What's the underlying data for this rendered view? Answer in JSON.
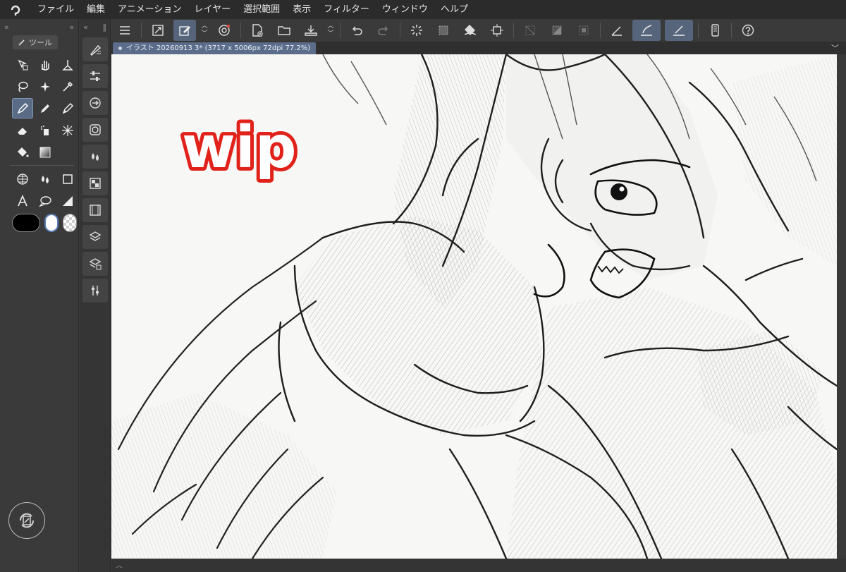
{
  "app": {
    "logo_icon": "clip-studio-logo-icon",
    "accent_color": "#5b6d8a"
  },
  "menu": {
    "items": [
      "ファイル",
      "編集",
      "アニメーション",
      "レイヤー",
      "選択範囲",
      "表示",
      "フィルター",
      "ウィンドウ",
      "ヘルプ"
    ]
  },
  "tool_panel": {
    "tab_label": "ツール",
    "tools": [
      {
        "name": "operation-tool",
        "icon": "cursor-cube-icon"
      },
      {
        "name": "move-tool",
        "icon": "hand-icon"
      },
      {
        "name": "move-layer-tool",
        "icon": "move-layer-icon"
      },
      {
        "name": "lasso-tool",
        "icon": "lasso-icon"
      },
      {
        "name": "auto-select-tool",
        "icon": "sparkle-icon"
      },
      {
        "name": "eyedropper-tool",
        "icon": "eyedropper-icon"
      },
      {
        "name": "pen-tool",
        "icon": "pen-icon",
        "active": true
      },
      {
        "name": "pencil-tool",
        "icon": "pencil-icon"
      },
      {
        "name": "brush-tool",
        "icon": "brush-icon"
      },
      {
        "name": "eraser-tool",
        "icon": "eraser-icon"
      },
      {
        "name": "airbrush-tool",
        "icon": "airbrush-icon"
      },
      {
        "name": "decoration-tool",
        "icon": "burst-icon"
      },
      {
        "name": "fill-tool",
        "icon": "bucket-icon"
      },
      {
        "name": "gradient-tool",
        "icon": "gradient-icon"
      },
      {
        "name": "figure-tool",
        "icon": "shape-icon"
      },
      {
        "name": "frame-tool",
        "icon": "grid-frame-icon"
      },
      {
        "name": "blend-tool",
        "icon": "droplets-icon"
      },
      {
        "name": "rectangle-tool",
        "icon": "square-icon"
      },
      {
        "name": "text-tool",
        "icon": "text-a-icon"
      },
      {
        "name": "balloon-tool",
        "icon": "speech-bubble-icon"
      },
      {
        "name": "ruler-tool",
        "icon": "ruler-triangle-icon"
      }
    ],
    "main_color": "#000000",
    "sub_color": "#ffffff"
  },
  "palette_column": {
    "buttons": [
      "brush-settings-icon",
      "sliders-icon",
      "sub-tool-icon",
      "color-circle-icon",
      "droplets-icon",
      "material-icon",
      "filmstrip-icon",
      "layers-icon",
      "layer-property-icon",
      "adjust-icon"
    ]
  },
  "command_bar": {
    "buttons": [
      "hamburger-menu-icon",
      "new-canvas-icon",
      "edit-icon",
      "spiral-icon",
      "new-file-icon",
      "open-folder-icon",
      "save-icon",
      "undo-icon",
      "redo-icon",
      "loading-icon",
      "select-all-icon",
      "fill-shape-icon",
      "crop-icon",
      "hide-selection-icon",
      "invert-selection-icon",
      "clear-selection-icon",
      "ruler-snap-icon",
      "snap-special-ruler-icon",
      "snap-grid-icon",
      "smartphone-icon",
      "help-icon"
    ]
  },
  "document": {
    "tab_title": "イラスト 20260913 3* (3717 x 5006px 72dpi 77.2%)",
    "watermark": "wip"
  }
}
